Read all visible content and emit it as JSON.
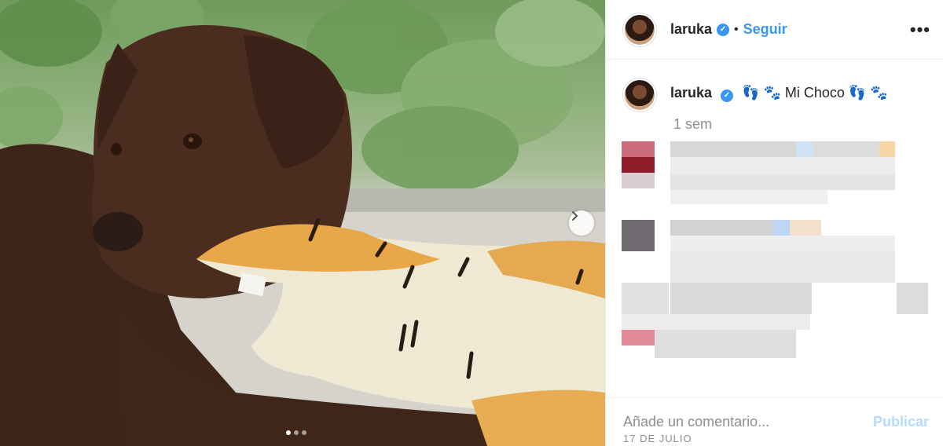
{
  "post": {
    "author": {
      "username": "laruka",
      "verified": true,
      "separator": "•",
      "follow_label": "Seguir"
    },
    "more_icon": "more-horizontal-icon",
    "caption": {
      "username": "laruka",
      "text": "👣 🐾  Mi Choco 👣 🐾"
    },
    "time_ago": "1 sem",
    "date": "17 DE JULIO",
    "comment_box": {
      "placeholder": "Añade un comentario...",
      "publish_label": "Publicar"
    },
    "carousel": {
      "slides": 3,
      "active_index": 0,
      "next_icon": "chevron-right-icon"
    },
    "colors": {
      "link_blue": "#3897f0",
      "publish_disabled": "#b3dbff",
      "muted_text": "#8e8e8e"
    }
  }
}
